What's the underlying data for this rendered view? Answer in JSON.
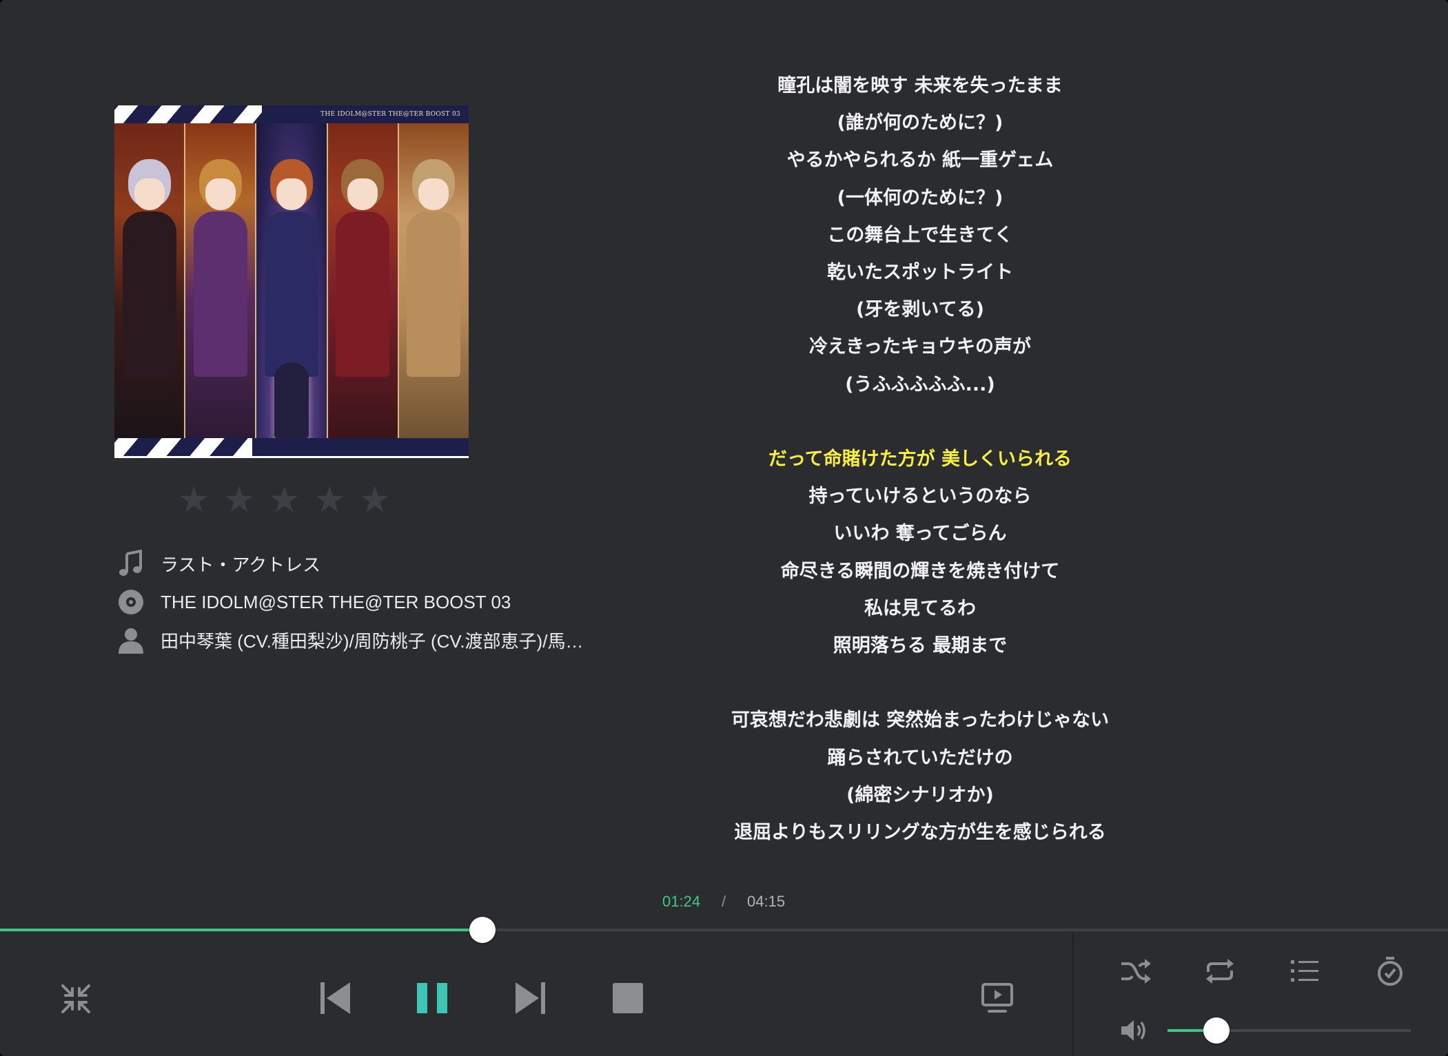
{
  "album_art": {
    "caption": "THE IDOLM@STER THE@TER BOOST 03"
  },
  "rating": {
    "stars_total": 5,
    "stars_filled": 0,
    "star_glyph": "★"
  },
  "track": {
    "title": "ラスト・アクトレス",
    "album": "THE IDOLM@STER THE@TER BOOST 03",
    "artist": "田中琴葉 (CV.種田梨沙)/周防桃子 (CV.渡部恵子)/馬…",
    "title_icon": "music-note-icon",
    "album_icon": "disc-icon",
    "artist_icon": "person-icon"
  },
  "lyrics": {
    "lines": [
      "瞳孔は闇を映す 未来を失ったまま",
      "(誰が何のために？)",
      "やるかやられるか 紙一重ゲェム",
      "(一体何のために？)",
      "この舞台上で生きてく",
      "乾いたスポットライト",
      "(牙を剥いてる)",
      "冷えきったキョウキの声が",
      "(うふふふふふ...)",
      "",
      "だって命賭けた方が 美しくいられる",
      "持っていけるというのなら",
      "いいわ 奪ってごらん",
      "命尽きる瞬間の輝きを焼き付けて",
      "私は見てるわ",
      "照明落ちる 最期まで",
      "",
      "可哀想だわ悲劇は 突然始まったわけじゃない",
      "踊らされていただけの",
      "(綿密シナリオか)",
      "退屈よりもスリリングな方が生を感じられる"
    ],
    "active_index": 10
  },
  "playback": {
    "current_time": "01:24",
    "separator": "/",
    "total_time": "04:15",
    "progress": 0.333,
    "volume": 0.2
  },
  "controls": {
    "minimize_icon": "collapse-icon",
    "previous_icon": "skip-previous-icon",
    "pause_icon": "pause-icon",
    "next_icon": "skip-next-icon",
    "stop_icon": "stop-icon",
    "lyrics_display_icon": "display-icon",
    "shuffle_icon": "shuffle-icon",
    "repeat_icon": "repeat-icon",
    "playlist_icon": "playlist-icon",
    "timer_icon": "timer-icon",
    "volume_icon": "volume-icon"
  },
  "colors": {
    "background": "#2b2c2f",
    "accent": "#41c485",
    "highlight_lyric": "#f7ef46",
    "pause_button": "#3fc5b3",
    "icon_gray": "#8d8e92"
  }
}
